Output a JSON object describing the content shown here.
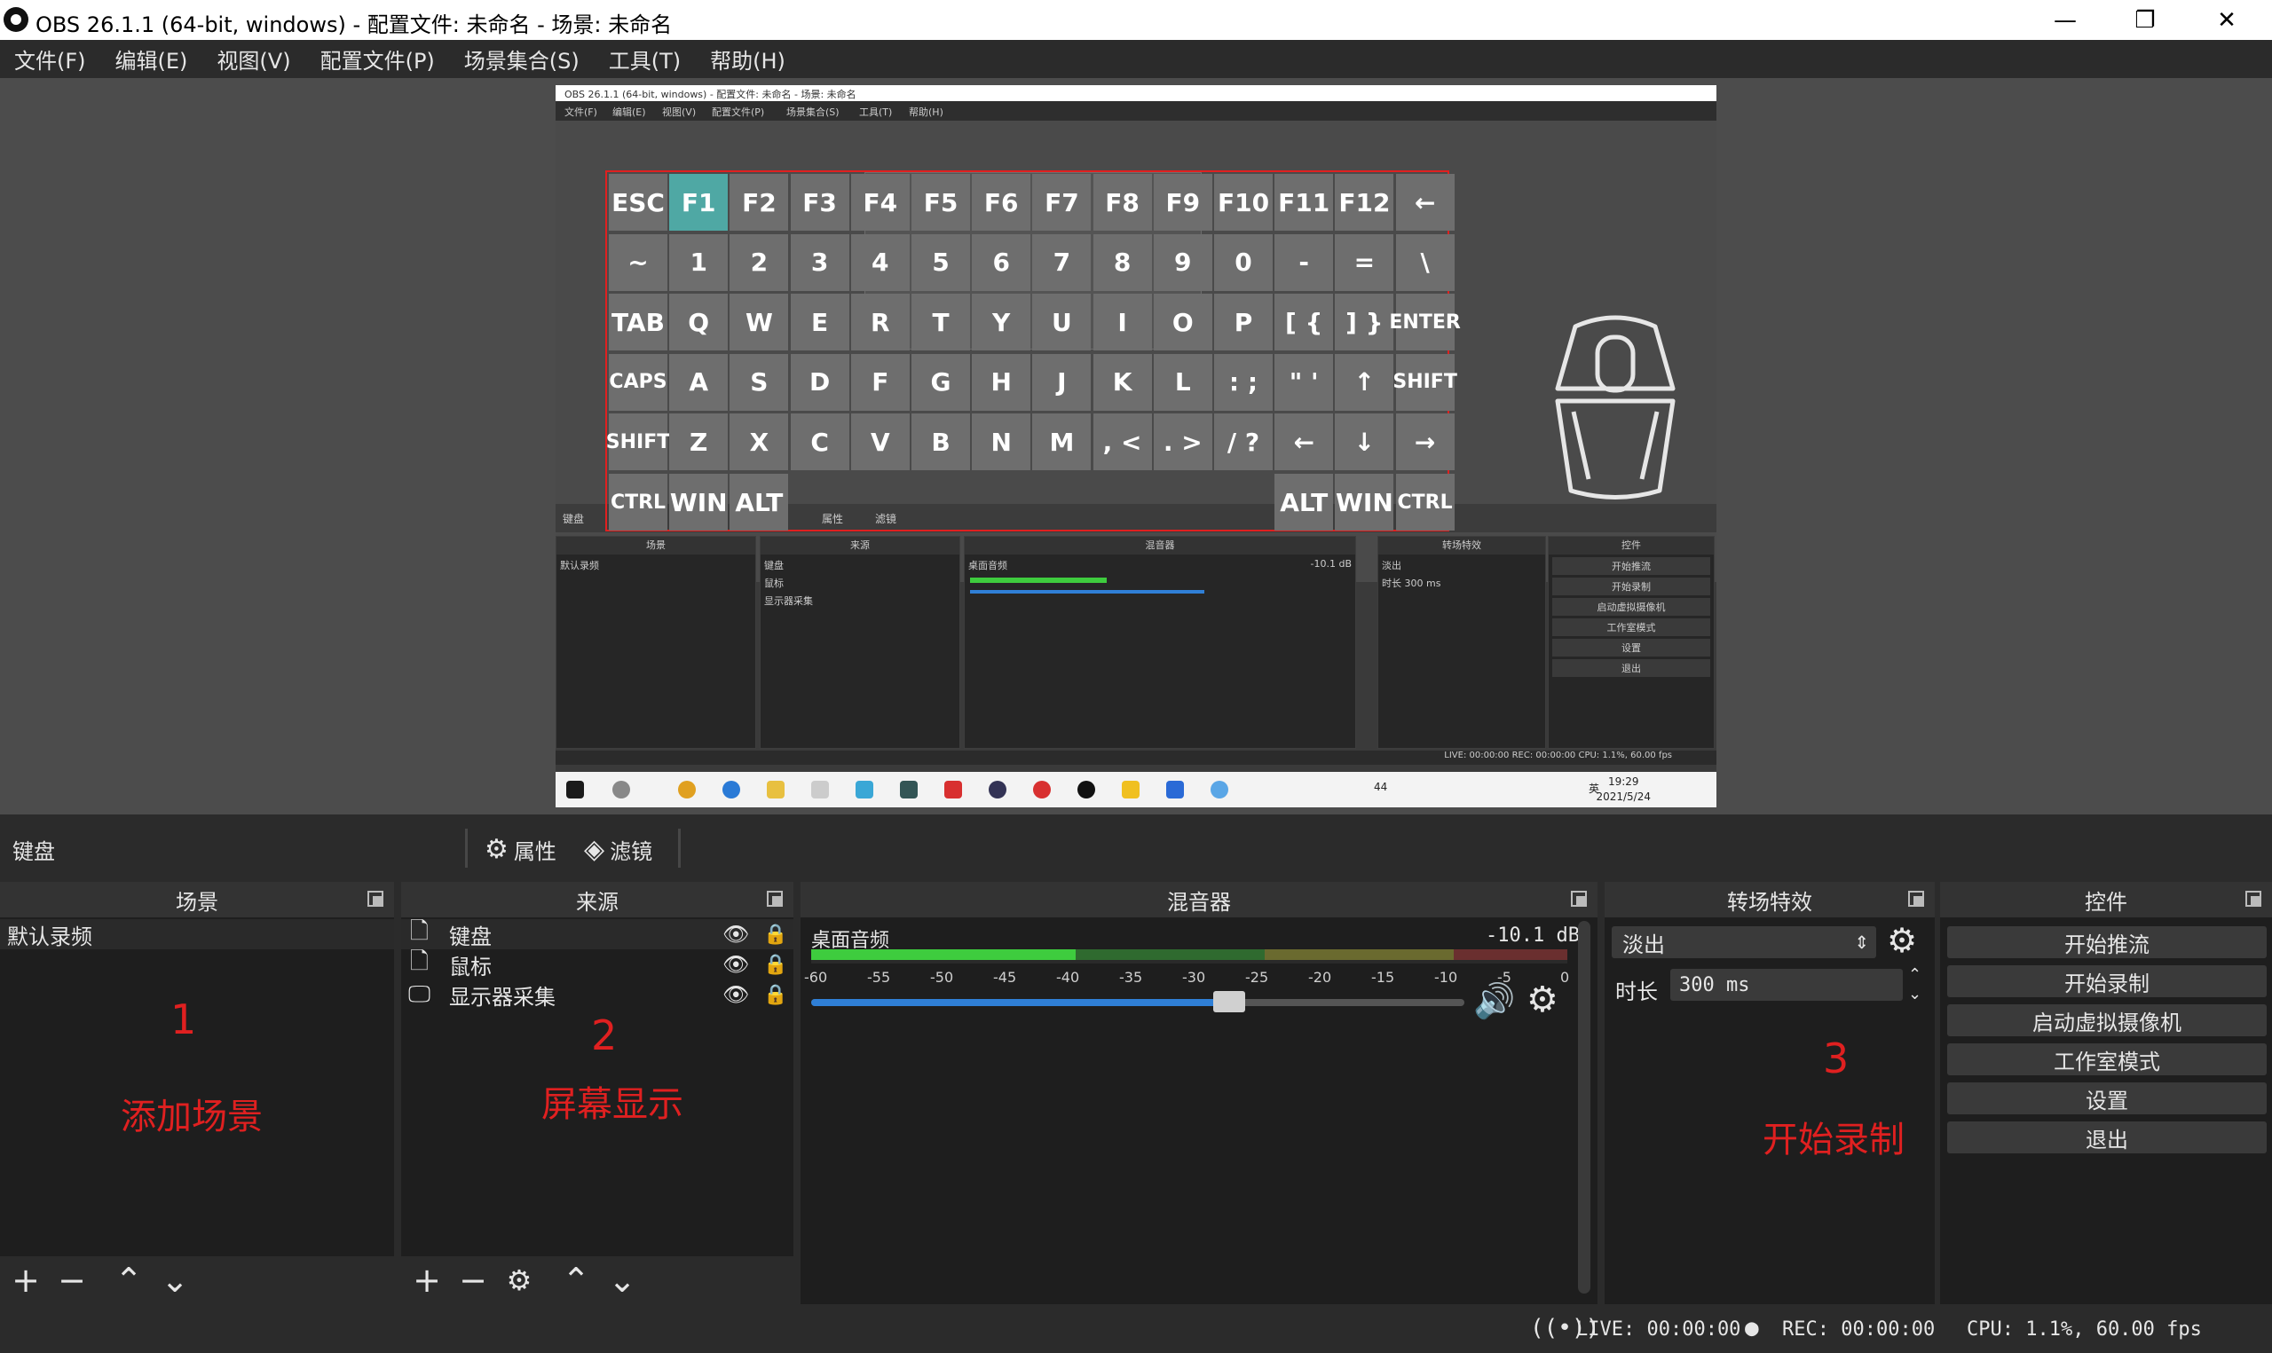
{
  "window": {
    "title": "OBS 26.1.1 (64-bit, windows) - 配置文件: 未命名 - 场景: 未命名",
    "minimize": "—",
    "maximize": "❐",
    "close": "✕"
  },
  "menu": [
    "文件(F)",
    "编辑(E)",
    "视图(V)",
    "配置文件(P)",
    "场景集合(S)",
    "工具(T)",
    "帮助(H)"
  ],
  "captured": {
    "title": "OBS 26.1.1 (64-bit, windows) - 配置文件: 未命名 - 场景: 未命名",
    "menu": [
      "文件(F)",
      "编辑(E)",
      "视图(V)",
      "配置文件(P)",
      "场景集合(S)",
      "工具(T)",
      "帮助(H)"
    ],
    "scene_label": "键盘",
    "props_label": "属性",
    "filters_label": "滤镜",
    "docks": [
      "场景",
      "来源",
      "混音器",
      "转场特效",
      "控件"
    ],
    "default_scene": "默认录频",
    "sources": [
      "键盘",
      "鼠标",
      "显示器采集"
    ],
    "mixer_source": "桌面音频",
    "mixer_db": "-10.1 dB",
    "transition": "淡出",
    "duration_label": "时长",
    "duration": "300 ms",
    "controls": [
      "开始推流",
      "开始录制",
      "启动虚拟摄像机",
      "工作室模式",
      "设置",
      "退出"
    ],
    "status": "LIVE: 00:00:00   REC: 00:00:00   CPU: 1.1%, 60.00 fps",
    "clock_time": "19:29",
    "clock_date": "2021/5/24",
    "battery": "44",
    "ime": "英"
  },
  "keyboard": {
    "rows": [
      [
        "ESC",
        "F1",
        "F2",
        "F3",
        "F4",
        "F5",
        "F6",
        "F7",
        "F8",
        "F9",
        "F10",
        "F11",
        "F12",
        "←"
      ],
      [
        "~",
        "1",
        "2",
        "3",
        "4",
        "5",
        "6",
        "7",
        "8",
        "9",
        "0",
        "-",
        "=",
        "\\"
      ],
      [
        "TAB",
        "Q",
        "W",
        "E",
        "R",
        "T",
        "Y",
        "U",
        "I",
        "O",
        "P",
        "[ {",
        "] }",
        "ENTER"
      ],
      [
        "CAPS",
        "A",
        "S",
        "D",
        "F",
        "G",
        "H",
        "J",
        "K",
        "L",
        ": ;",
        "\" '",
        "↑",
        "SHIFT"
      ],
      [
        "SHIFT",
        "Z",
        "X",
        "C",
        "V",
        "B",
        "N",
        "M",
        ", <",
        ". >",
        "/ ?",
        "←",
        "↓",
        "→"
      ],
      [
        "CTRL",
        "WIN",
        "ALT",
        "",
        "",
        "",
        "",
        "",
        "",
        "",
        "",
        "ALT",
        "WIN",
        "CTRL"
      ]
    ],
    "active_key": "F1"
  },
  "scene_toolbar": {
    "scene_name": "键盘",
    "properties": "属性",
    "filters": "滤镜"
  },
  "docks": {
    "scenes": {
      "title": "场景",
      "items": [
        "默认录频"
      ]
    },
    "sources": {
      "title": "来源",
      "items": [
        {
          "name": "键盘",
          "icon": "file-icon"
        },
        {
          "name": "鼠标",
          "icon": "file-icon"
        },
        {
          "name": "显示器采集",
          "icon": "monitor-icon"
        }
      ]
    },
    "mixer": {
      "title": "混音器",
      "source": "桌面音频",
      "db": "-10.1 dB",
      "ticks": [
        "-60",
        "-55",
        "-50",
        "-45",
        "-40",
        "-35",
        "-30",
        "-25",
        "-20",
        "-15",
        "-10",
        "-5",
        "0"
      ],
      "volume_level": 0.64,
      "meter_level": 0.35
    },
    "transitions": {
      "title": "转场特效",
      "selected": "淡出",
      "duration_label": "时长",
      "duration": "300 ms"
    },
    "controls": {
      "title": "控件",
      "buttons": [
        "开始推流",
        "开始录制",
        "启动虚拟摄像机",
        "工作室模式",
        "设置",
        "退出"
      ]
    }
  },
  "annotations": [
    {
      "number": "1",
      "text": "添加场景"
    },
    {
      "number": "2",
      "text": "屏幕显示"
    },
    {
      "number": "3",
      "text": "开始录制"
    }
  ],
  "status": {
    "live": "LIVE: 00:00:00",
    "rec": "REC: 00:00:00",
    "cpu": "CPU: 1.1%, 60.00 fps"
  },
  "colors": {
    "accent_key": "#4fa8a4",
    "annotation": "#e02020",
    "meter_green": "#3ecc3e",
    "meter_yellow": "#c8b83e",
    "meter_red": "#cc3e3e",
    "volume_blue": "#2f7fd6"
  }
}
